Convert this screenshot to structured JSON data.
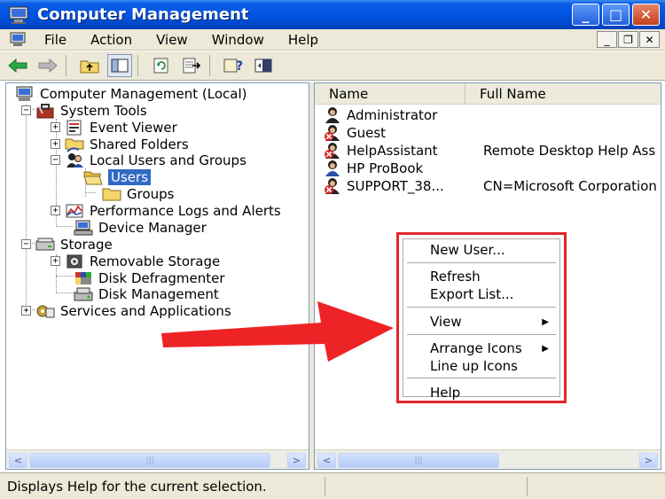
{
  "window": {
    "title": "Computer Management",
    "buttons": {
      "minimize": "_",
      "maximize": "□",
      "close": "✕"
    }
  },
  "menubar": {
    "items": [
      "File",
      "Action",
      "View",
      "Window",
      "Help"
    ]
  },
  "tree": {
    "root": "Computer Management (Local)",
    "system_tools": "System Tools",
    "event_viewer": "Event Viewer",
    "shared_folders": "Shared Folders",
    "local_users_groups": "Local Users and Groups",
    "users": "Users",
    "groups": "Groups",
    "perf_logs": "Performance Logs and Alerts",
    "device_manager": "Device Manager",
    "storage": "Storage",
    "removable_storage": "Removable Storage",
    "disk_defrag": "Disk Defragmenter",
    "disk_mgmt": "Disk Management",
    "services_apps": "Services and Applications",
    "expanders": {
      "plus": "+",
      "minus": "−"
    }
  },
  "list": {
    "columns": [
      "Name",
      "Full Name"
    ],
    "rows": [
      {
        "name": "Administrator",
        "full_name": "",
        "disabled": false
      },
      {
        "name": "Guest",
        "full_name": "",
        "disabled": true
      },
      {
        "name": "HelpAssistant",
        "full_name": "Remote Desktop Help Ass",
        "disabled": true
      },
      {
        "name": "HP ProBook",
        "full_name": "",
        "disabled": false
      },
      {
        "name": "SUPPORT_38...",
        "full_name": "CN=Microsoft Corporation",
        "disabled": true
      }
    ]
  },
  "context_menu": {
    "new_user": "New User...",
    "refresh": "Refresh",
    "export_list": "Export List...",
    "view": "View",
    "arrange_icons": "Arrange Icons",
    "line_up_icons": "Line up Icons",
    "help": "Help",
    "submenu_arrow": "▶"
  },
  "scroll": {
    "left": "<",
    "right": ">",
    "grip": "|||"
  },
  "status": {
    "text": "Displays Help for the current selection."
  },
  "colors": {
    "highlight": "#e3262a",
    "selection": "#316ac5",
    "titlebar": "#0054e3"
  }
}
